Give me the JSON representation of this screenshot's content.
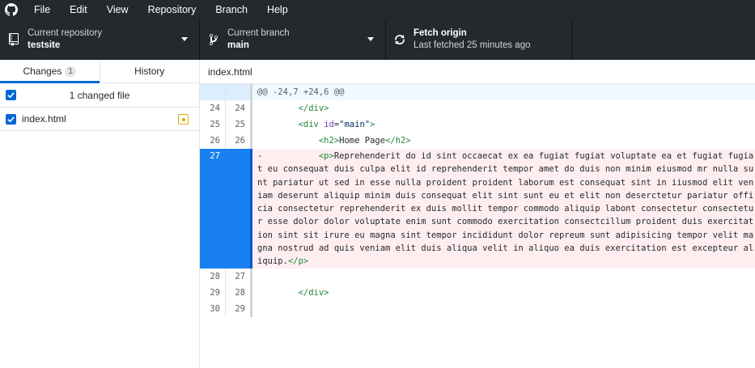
{
  "menu": [
    "File",
    "Edit",
    "View",
    "Repository",
    "Branch",
    "Help"
  ],
  "toolbar": {
    "repo_label": "Current repository",
    "repo_value": "testsite",
    "branch_label": "Current branch",
    "branch_value": "main",
    "fetch_title": "Fetch origin",
    "fetch_sub": "Last fetched 25 minutes ago"
  },
  "sidebar": {
    "tab_changes": "Changes",
    "tab_changes_count": "1",
    "tab_history": "History",
    "changed_files_label": "1 changed file",
    "files": [
      {
        "name": "index.html",
        "status": "modified"
      }
    ]
  },
  "diff": {
    "file": "index.html",
    "hunk": "@@ -24,7 +24,6 @@",
    "lines": [
      {
        "old": "24",
        "new": "24",
        "indent": "        ",
        "parts": [
          [
            "t",
            "</div>"
          ]
        ]
      },
      {
        "old": "25",
        "new": "25",
        "indent": "        ",
        "parts": [
          [
            "t",
            "<div "
          ],
          [
            "a",
            "id"
          ],
          [
            "p",
            "="
          ],
          [
            "s",
            "\"main\""
          ],
          [
            "t",
            ">"
          ]
        ]
      },
      {
        "old": "26",
        "new": "26",
        "indent": "            ",
        "parts": [
          [
            "t",
            "<h2>"
          ],
          [
            "p",
            "Home Page"
          ],
          [
            "t",
            "</h2>"
          ]
        ]
      }
    ],
    "deleted": {
      "old": "27",
      "new": "",
      "prefix": "-           ",
      "open_tag": "<p>",
      "text": "Reprehenderit do id sint occaecat ex ea fugiat fugiat voluptate ea et fugiat fugiat eu consequat duis culpa elit id reprehenderit tempor amet do duis non minim eiusmod mr nulla sunt pariatur ut sed in esse nulla proident proident laborum est consequat sint in iiusmod elit veniam deserunt aliquip minim duis consequat elit sint sunt eu et elit non deserctetur pariatur officia consectetur reprehenderit ex duis mollit tempor commodo aliquip labont consectetur consectetur esse dolor dolor voluptate enim sunt commodo exercitation consectcillum proident duis exercitation sint sit irure eu magna sint tempor incididunt dolor repreum sunt adipisicing tempor velit magna nostrud ad quis veniam elit duis aliqua velit in aliquo ea duis exercitation est excepteur aliquip.",
      "close_tag": "</p>"
    },
    "tail": [
      {
        "old": "28",
        "new": "27",
        "indent": "",
        "parts": []
      },
      {
        "old": "29",
        "new": "28",
        "indent": "        ",
        "parts": [
          [
            "t",
            "</div>"
          ]
        ]
      },
      {
        "old": "30",
        "new": "29",
        "indent": "",
        "parts": []
      }
    ]
  }
}
